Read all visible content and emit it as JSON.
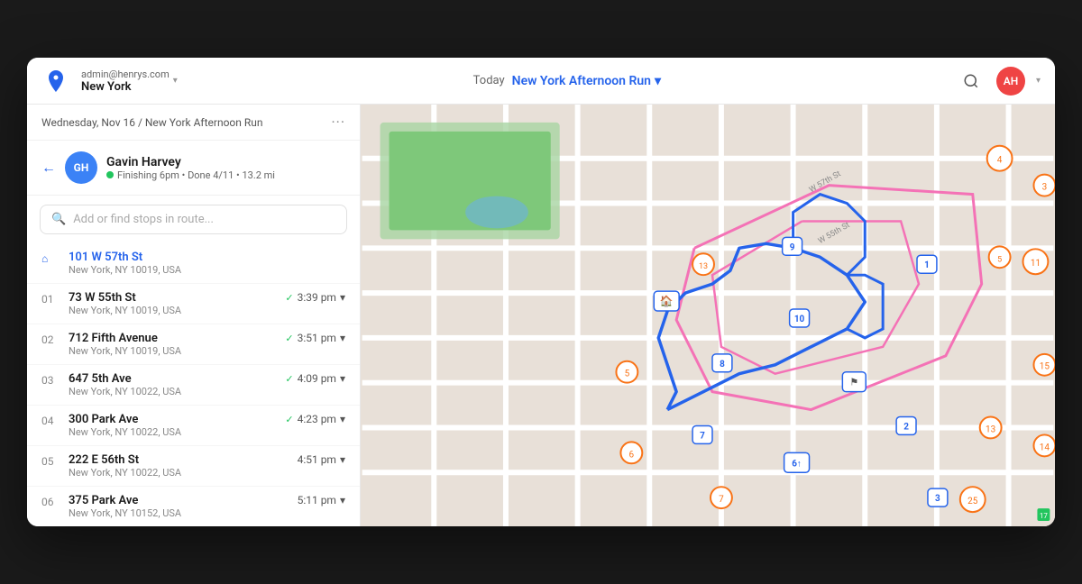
{
  "header": {
    "logo_color": "#2563eb",
    "account": {
      "email": "admin@henrys.com",
      "city": "New York"
    },
    "today_label": "Today",
    "route_name": "New York Afternoon Run",
    "avatar_initials": "AH"
  },
  "sidebar": {
    "date_label": "Wednesday, Nov 16 / New York Afternoon Run",
    "driver": {
      "initials": "GH",
      "name": "Gavin Harvey",
      "status": "Finishing 6pm • Done 4/11 • 13.2 mi"
    },
    "search_placeholder": "Add or find stops in route...",
    "stops": [
      {
        "number": "🏠",
        "type": "home",
        "street": "101 W 57th St",
        "city": "New York, NY 10019, USA",
        "time": "",
        "checked": false
      },
      {
        "number": "01",
        "type": "stop",
        "street": "73 W 55th St",
        "city": "New York, NY 10019, USA",
        "time": "3:39 pm",
        "checked": true
      },
      {
        "number": "02",
        "type": "stop",
        "street": "712 Fifth Avenue",
        "city": "New York, NY 10019, USA",
        "time": "3:51 pm",
        "checked": true
      },
      {
        "number": "03",
        "type": "stop",
        "street": "647 5th Ave",
        "city": "New York, NY 10022, USA",
        "time": "4:09 pm",
        "checked": true
      },
      {
        "number": "04",
        "type": "stop",
        "street": "300 Park Ave",
        "city": "New York, NY 10022, USA",
        "time": "4:23 pm",
        "checked": true
      },
      {
        "number": "05",
        "type": "stop",
        "street": "222 E 56th St",
        "city": "New York, NY 10022, USA",
        "time": "4:51 pm",
        "checked": false
      },
      {
        "number": "06",
        "type": "stop",
        "street": "375 Park Ave",
        "city": "New York, NY 10152, USA",
        "time": "5:11 pm",
        "checked": false
      }
    ]
  }
}
